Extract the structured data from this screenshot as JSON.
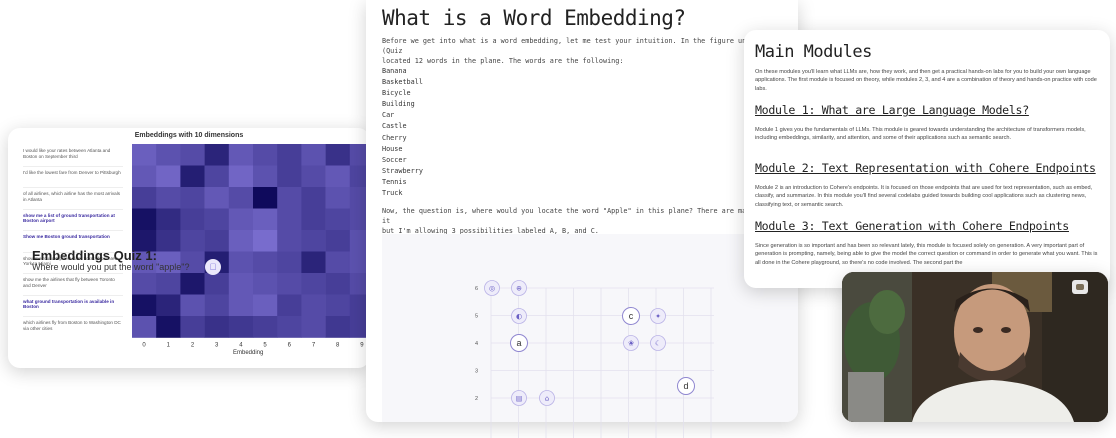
{
  "heatmap": {
    "title": "Embeddings with 10 dimensions",
    "xlabel": "Embedding",
    "queries": [
      {
        "text": "I would like your rates between Atlanta and Boston on September third",
        "highlight": false
      },
      {
        "text": "I'd like the lowest fare from Denver to Pittsburgh",
        "highlight": false
      },
      {
        "text": "of all airlines, which airline has the most arrivals in Atlanta",
        "highlight": false
      },
      {
        "text": "show me a list of ground transportation at Boston airport",
        "highlight": true
      },
      {
        "text": "Show me Boston ground transportation",
        "highlight": true
      },
      {
        "text": "show me round trip first class tickets from New York to Miami",
        "highlight": false
      },
      {
        "text": "show me the airlines that fly between Toronto and Denver",
        "highlight": false
      },
      {
        "text": "what ground transportation is available in Boston",
        "highlight": true
      },
      {
        "text": "which airlines fly from Boston to Washington DC via other cities",
        "highlight": false
      }
    ],
    "x_ticks": [
      "0",
      "1",
      "2",
      "3",
      "4",
      "5",
      "6",
      "7",
      "8",
      "9"
    ],
    "cells": [
      [
        0.35,
        0.45,
        0.5,
        0.8,
        0.4,
        0.5,
        0.6,
        0.45,
        0.7,
        0.5
      ],
      [
        0.4,
        0.3,
        0.85,
        0.55,
        0.3,
        0.45,
        0.6,
        0.5,
        0.4,
        0.55
      ],
      [
        0.6,
        0.5,
        0.55,
        0.4,
        0.5,
        1.0,
        0.5,
        0.6,
        0.45,
        0.5
      ],
      [
        0.95,
        0.75,
        0.6,
        0.55,
        0.4,
        0.35,
        0.5,
        0.6,
        0.55,
        0.5
      ],
      [
        0.9,
        0.7,
        0.55,
        0.6,
        0.35,
        0.25,
        0.5,
        0.55,
        0.6,
        0.45
      ],
      [
        0.4,
        0.35,
        0.5,
        0.85,
        0.45,
        0.5,
        0.55,
        0.8,
        0.5,
        0.45
      ],
      [
        0.5,
        0.55,
        0.9,
        0.6,
        0.4,
        0.45,
        0.5,
        0.55,
        0.6,
        0.5
      ],
      [
        0.95,
        0.8,
        0.45,
        0.55,
        0.4,
        0.35,
        0.6,
        0.5,
        0.55,
        0.6
      ],
      [
        0.45,
        0.95,
        0.6,
        0.7,
        0.65,
        0.6,
        0.55,
        0.5,
        0.65,
        0.6
      ]
    ],
    "color_low": "#9b8cf2",
    "color_high": "#0f0a5c"
  },
  "embedding_page": {
    "title": "What is a Word Embedding?",
    "intro_line1": "Before we get into what is a word embedding, let me test your intuition. In the figure underneath (Quiz",
    "intro_line2": "located 12 words in the plane. The words are the following:",
    "words": [
      "Banana",
      "Basketball",
      "Bicycle",
      "Building",
      "Car",
      "Castle",
      "Cherry",
      "House",
      "Soccer",
      "Strawberry",
      "Tennis",
      "Truck"
    ],
    "question_line1": "Now, the question is, where would you locate the word \"Apple\" in this plane? There are many places it",
    "question_line2": "but I'm allowing 3 possibilities labeled A, B, and C.",
    "quiz_title": "Embeddings Quiz 1:",
    "quiz_subtitle": "Where would you put the word \"apple\"?",
    "quiz_y_ticks": [
      "6",
      "5",
      "4",
      "3",
      "2"
    ],
    "quiz_letters": [
      "a",
      "c",
      "d"
    ]
  },
  "modules_page": {
    "title": "Main Modules",
    "intro": "On these modules you'll learn what LLMs are, how they work, and then get a practical hands-on labs for you to build your own language applications. The first module is focused on theory, while modules 2, 3, and 4 are a combination of theory and hands-on practice with code labs.",
    "modules": [
      {
        "heading": "Module 1: What are Large Language Models?",
        "text": "Module 1 gives you the fundamentals of LLMs. This module is geared towards understanding the architecture of transformers models, including embeddings, similarity, and attention, and some of their applications such as semantic search."
      },
      {
        "heading": "Module 2: Text Representation with Cohere Endpoints",
        "text": "Module 2 is an introduction to Cohere's endpoints. It is focused on those endpoints that are used for text representation, such as embed, classify, and summarize. In this module you'll find several codelabs guided towards building cool applications such as clustering news, classifying text, or semantic search."
      },
      {
        "heading": "Module 3: Text Generation with Cohere Endpoints",
        "text": "Since generation is so important and has been so relevant lately, this module is focused solely on generation. A very important part of generation is prompting, namely, being able to give the model the correct question or command in order to generate what you want. This is all done in the Cohere playground, so there's no code involved. The second part the"
      }
    ]
  }
}
